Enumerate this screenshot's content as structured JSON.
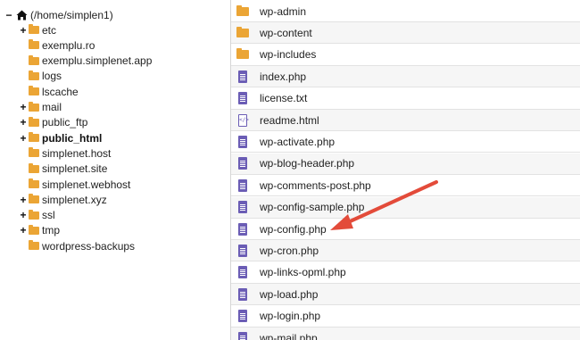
{
  "tree": {
    "root_label": "(/home/simplen1)",
    "items": [
      {
        "label": "etc",
        "toggle": "+",
        "bold": false
      },
      {
        "label": "exemplu.ro",
        "toggle": "",
        "bold": false
      },
      {
        "label": "exemplu.simplenet.app",
        "toggle": "",
        "bold": false
      },
      {
        "label": "logs",
        "toggle": "",
        "bold": false
      },
      {
        "label": "lscache",
        "toggle": "",
        "bold": false
      },
      {
        "label": "mail",
        "toggle": "+",
        "bold": false
      },
      {
        "label": "public_ftp",
        "toggle": "+",
        "bold": false
      },
      {
        "label": "public_html",
        "toggle": "+",
        "bold": true
      },
      {
        "label": "simplenet.host",
        "toggle": "",
        "bold": false
      },
      {
        "label": "simplenet.site",
        "toggle": "",
        "bold": false
      },
      {
        "label": "simplenet.webhost",
        "toggle": "",
        "bold": false
      },
      {
        "label": "simplenet.xyz",
        "toggle": "+",
        "bold": false
      },
      {
        "label": "ssl",
        "toggle": "+",
        "bold": false
      },
      {
        "label": "tmp",
        "toggle": "+",
        "bold": false
      },
      {
        "label": "wordpress-backups",
        "toggle": "",
        "bold": false
      }
    ]
  },
  "files": [
    {
      "name": "wp-admin",
      "icon": "folder-icon"
    },
    {
      "name": "wp-content",
      "icon": "folder-icon"
    },
    {
      "name": "wp-includes",
      "icon": "folder-icon"
    },
    {
      "name": "index.php",
      "icon": "php-file-icon"
    },
    {
      "name": "license.txt",
      "icon": "text-file-icon"
    },
    {
      "name": "readme.html",
      "icon": "html-file-icon"
    },
    {
      "name": "wp-activate.php",
      "icon": "php-file-icon"
    },
    {
      "name": "wp-blog-header.php",
      "icon": "php-file-icon"
    },
    {
      "name": "wp-comments-post.php",
      "icon": "php-file-icon"
    },
    {
      "name": "wp-config-sample.php",
      "icon": "php-file-icon"
    },
    {
      "name": "wp-config.php",
      "icon": "php-file-icon"
    },
    {
      "name": "wp-cron.php",
      "icon": "php-file-icon"
    },
    {
      "name": "wp-links-opml.php",
      "icon": "php-file-icon"
    },
    {
      "name": "wp-load.php",
      "icon": "php-file-icon"
    },
    {
      "name": "wp-login.php",
      "icon": "php-file-icon"
    },
    {
      "name": "wp-mail.php",
      "icon": "php-file-icon"
    }
  ],
  "colors": {
    "folder": "#eba535",
    "file_icon": "#6b5db5",
    "arrow": "#e34b3a"
  }
}
